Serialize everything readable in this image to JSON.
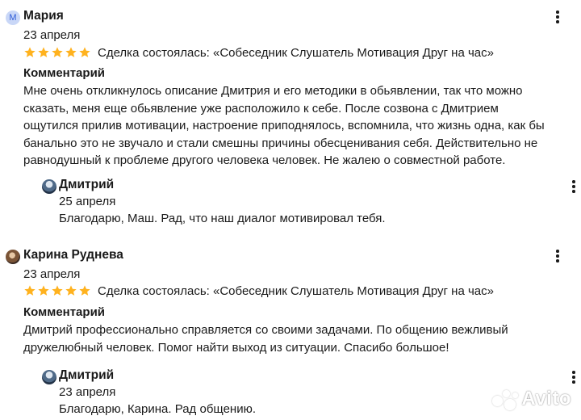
{
  "reviews": [
    {
      "author": "Мария",
      "avatar_letter": "М",
      "date": "23 апреля",
      "rating": 5,
      "deal": "Сделка состоялась: «Собеседник Слушатель Мотивация Друг на час»",
      "comment_label": "Комментарий",
      "comment_lines": [
        "Мне очень откликнулось описание Дмитрия и его методики в обьявлении, так что можно",
        "сказать, меня еще обьявление уже расположило к себе. После созвона с Дмитрием",
        "ощутился прилив мотивации, настроение приподнялось, вспомнила, что жизнь одна, как бы",
        "банально это не звучало и стали смешны причины обесценивания себя. Действительно не",
        "равнодушный к проблеме другого человека человек. Не жалею о совместной работе."
      ],
      "reply": {
        "author": "Дмитрий",
        "date": "25 апреля",
        "text": "Благодарю, Маш. Рад, что наш диалог мотивировал тебя."
      }
    },
    {
      "author": "Карина Руднева",
      "date": "23 апреля",
      "rating": 5,
      "deal": "Сделка состоялась: «Собеседник Слушатель Мотивация Друг на час»",
      "comment_label": "Комментарий",
      "comment_lines": [
        "Дмитрий профессионально справляется со своими задачами. По общению вежливый",
        "дружелюбный человек. Помог найти выход из ситуации. Спасибо большое!"
      ],
      "reply": {
        "author": "Дмитрий",
        "date": "23 апреля",
        "text": "Благодарю, Карина. Рад общению."
      }
    }
  ],
  "watermark": {
    "text": "Avito"
  },
  "colors": {
    "star": "#ffb21e",
    "text": "#1a1a1a",
    "avatar_bg": "#c9d7f7",
    "avatar_fg": "#2d5bd7"
  },
  "icons": {
    "menu": "more-vertical-icon",
    "star": "star-icon"
  }
}
